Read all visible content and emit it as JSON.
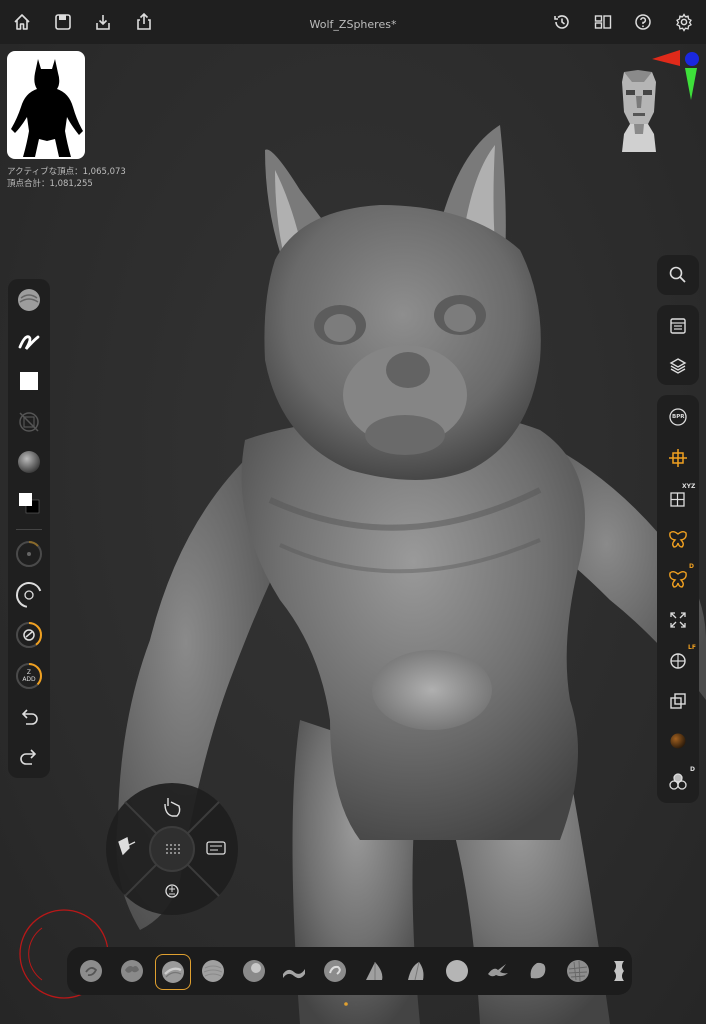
{
  "document": {
    "title": "Wolf_ZSpheres*"
  },
  "stats": {
    "active_points": "アクティブな頂点：1,065,073",
    "total_points": "頂点合計：1,081,255"
  },
  "topbar": {
    "left_icons": [
      "home-icon",
      "save-icon",
      "import-icon",
      "share-icon"
    ],
    "right_icons": [
      "history-icon",
      "layout-icon",
      "help-icon",
      "settings-icon"
    ]
  },
  "left_toolbar": {
    "items": [
      "brush-icon",
      "stroke-icon",
      "alpha-icon",
      "texture-off-icon",
      "material-icon",
      "color-icon",
      "draw-size-dial",
      "focal-shift-dial",
      "intensity-dial",
      "zadd-dial",
      "undo-icon",
      "redo-icon"
    ],
    "zadd_label_top": "Z",
    "zadd_label_bottom": "ADD",
    "accent": "#f0a020"
  },
  "right_toolbar": {
    "groups": [
      [
        "search-icon"
      ],
      [
        "subtool-list-icon",
        "layers-icon"
      ],
      [
        "bpr-icon",
        "transform-icon",
        "xyz-icon",
        "symmetry-icon",
        "radial-symmetry-icon",
        "fit-icon",
        "local-icon",
        "polyframe-icon",
        "material-sphere-icon",
        "solo-icon"
      ]
    ],
    "bpr_label": "BPR",
    "xyz_label": "XYZ",
    "d_label": "D",
    "lf_label": "LF",
    "solo_label": "D"
  },
  "brushes": {
    "items": [
      "clay-buildup-brush",
      "clay-brush",
      "standard-brush",
      "smooth-brush",
      "inflate-brush",
      "dam-standard-brush",
      "move-brush",
      "trim-brush",
      "pinch-brush",
      "sphere-brush",
      "snake-hook-brush",
      "flatten-brush",
      "hpolish-brush",
      "imm-brush"
    ],
    "selected_index": 2,
    "selected_color": "#e0a030"
  },
  "radial_menu": {
    "items": [
      "gesture-icon",
      "mask-paint-icon",
      "keyboard-icon",
      "plus-minus-icon",
      "grid-dots-icon"
    ]
  },
  "colors": {
    "accent": "#f0a020",
    "axis_x": "#e02a1a",
    "axis_y": "#3ee03a",
    "axis_z": "#1a28e0",
    "touch_ring": "#b81818"
  }
}
